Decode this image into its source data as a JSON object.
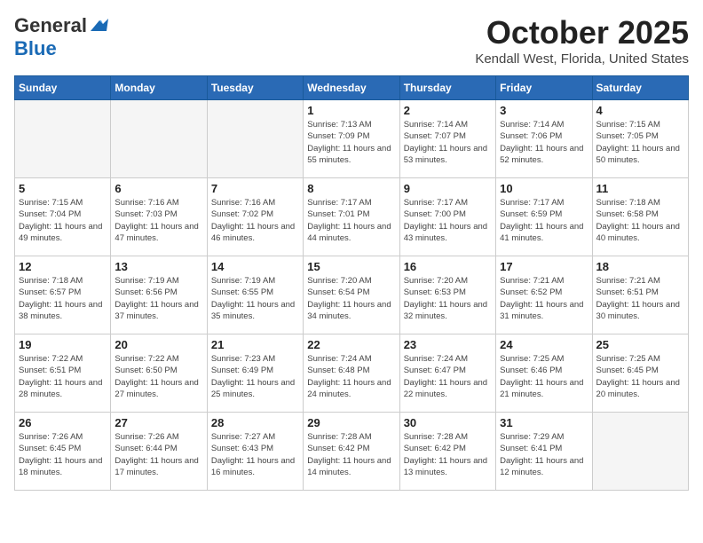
{
  "header": {
    "logo_general": "General",
    "logo_blue": "Blue",
    "month_title": "October 2025",
    "location": "Kendall West, Florida, United States"
  },
  "days_of_week": [
    "Sunday",
    "Monday",
    "Tuesday",
    "Wednesday",
    "Thursday",
    "Friday",
    "Saturday"
  ],
  "weeks": [
    [
      {
        "day": "",
        "empty": true
      },
      {
        "day": "",
        "empty": true
      },
      {
        "day": "",
        "empty": true
      },
      {
        "day": "1",
        "sunrise": "7:13 AM",
        "sunset": "7:09 PM",
        "daylight": "11 hours and 55 minutes."
      },
      {
        "day": "2",
        "sunrise": "7:14 AM",
        "sunset": "7:07 PM",
        "daylight": "11 hours and 53 minutes."
      },
      {
        "day": "3",
        "sunrise": "7:14 AM",
        "sunset": "7:06 PM",
        "daylight": "11 hours and 52 minutes."
      },
      {
        "day": "4",
        "sunrise": "7:15 AM",
        "sunset": "7:05 PM",
        "daylight": "11 hours and 50 minutes."
      }
    ],
    [
      {
        "day": "5",
        "sunrise": "7:15 AM",
        "sunset": "7:04 PM",
        "daylight": "11 hours and 49 minutes."
      },
      {
        "day": "6",
        "sunrise": "7:16 AM",
        "sunset": "7:03 PM",
        "daylight": "11 hours and 47 minutes."
      },
      {
        "day": "7",
        "sunrise": "7:16 AM",
        "sunset": "7:02 PM",
        "daylight": "11 hours and 46 minutes."
      },
      {
        "day": "8",
        "sunrise": "7:17 AM",
        "sunset": "7:01 PM",
        "daylight": "11 hours and 44 minutes."
      },
      {
        "day": "9",
        "sunrise": "7:17 AM",
        "sunset": "7:00 PM",
        "daylight": "11 hours and 43 minutes."
      },
      {
        "day": "10",
        "sunrise": "7:17 AM",
        "sunset": "6:59 PM",
        "daylight": "11 hours and 41 minutes."
      },
      {
        "day": "11",
        "sunrise": "7:18 AM",
        "sunset": "6:58 PM",
        "daylight": "11 hours and 40 minutes."
      }
    ],
    [
      {
        "day": "12",
        "sunrise": "7:18 AM",
        "sunset": "6:57 PM",
        "daylight": "11 hours and 38 minutes."
      },
      {
        "day": "13",
        "sunrise": "7:19 AM",
        "sunset": "6:56 PM",
        "daylight": "11 hours and 37 minutes."
      },
      {
        "day": "14",
        "sunrise": "7:19 AM",
        "sunset": "6:55 PM",
        "daylight": "11 hours and 35 minutes."
      },
      {
        "day": "15",
        "sunrise": "7:20 AM",
        "sunset": "6:54 PM",
        "daylight": "11 hours and 34 minutes."
      },
      {
        "day": "16",
        "sunrise": "7:20 AM",
        "sunset": "6:53 PM",
        "daylight": "11 hours and 32 minutes."
      },
      {
        "day": "17",
        "sunrise": "7:21 AM",
        "sunset": "6:52 PM",
        "daylight": "11 hours and 31 minutes."
      },
      {
        "day": "18",
        "sunrise": "7:21 AM",
        "sunset": "6:51 PM",
        "daylight": "11 hours and 30 minutes."
      }
    ],
    [
      {
        "day": "19",
        "sunrise": "7:22 AM",
        "sunset": "6:51 PM",
        "daylight": "11 hours and 28 minutes."
      },
      {
        "day": "20",
        "sunrise": "7:22 AM",
        "sunset": "6:50 PM",
        "daylight": "11 hours and 27 minutes."
      },
      {
        "day": "21",
        "sunrise": "7:23 AM",
        "sunset": "6:49 PM",
        "daylight": "11 hours and 25 minutes."
      },
      {
        "day": "22",
        "sunrise": "7:24 AM",
        "sunset": "6:48 PM",
        "daylight": "11 hours and 24 minutes."
      },
      {
        "day": "23",
        "sunrise": "7:24 AM",
        "sunset": "6:47 PM",
        "daylight": "11 hours and 22 minutes."
      },
      {
        "day": "24",
        "sunrise": "7:25 AM",
        "sunset": "6:46 PM",
        "daylight": "11 hours and 21 minutes."
      },
      {
        "day": "25",
        "sunrise": "7:25 AM",
        "sunset": "6:45 PM",
        "daylight": "11 hours and 20 minutes."
      }
    ],
    [
      {
        "day": "26",
        "sunrise": "7:26 AM",
        "sunset": "6:45 PM",
        "daylight": "11 hours and 18 minutes."
      },
      {
        "day": "27",
        "sunrise": "7:26 AM",
        "sunset": "6:44 PM",
        "daylight": "11 hours and 17 minutes."
      },
      {
        "day": "28",
        "sunrise": "7:27 AM",
        "sunset": "6:43 PM",
        "daylight": "11 hours and 16 minutes."
      },
      {
        "day": "29",
        "sunrise": "7:28 AM",
        "sunset": "6:42 PM",
        "daylight": "11 hours and 14 minutes."
      },
      {
        "day": "30",
        "sunrise": "7:28 AM",
        "sunset": "6:42 PM",
        "daylight": "11 hours and 13 minutes."
      },
      {
        "day": "31",
        "sunrise": "7:29 AM",
        "sunset": "6:41 PM",
        "daylight": "11 hours and 12 minutes."
      },
      {
        "day": "",
        "empty": true
      }
    ]
  ]
}
